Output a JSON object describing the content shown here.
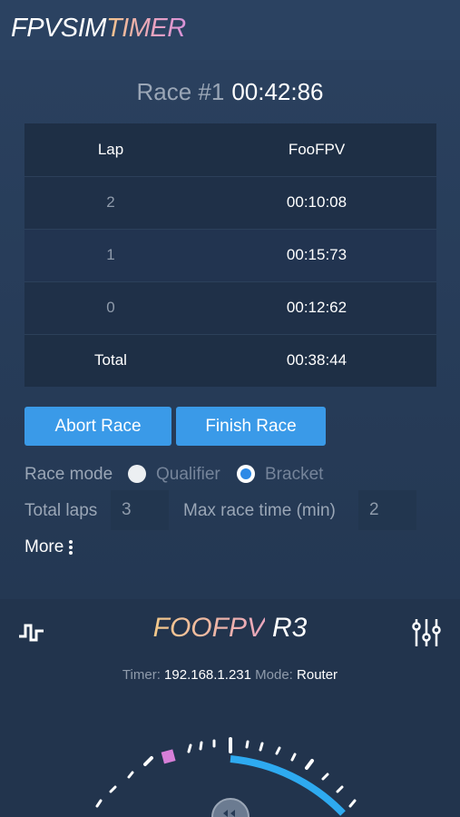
{
  "app": {
    "title_part1": "FPVSIM",
    "title_part2": "TIMER"
  },
  "race": {
    "label": "Race #1",
    "elapsed": "00:42:86"
  },
  "lap_table": {
    "headers": {
      "lap": "Lap",
      "pilot": "FooFPV"
    },
    "rows": [
      {
        "lap": "2",
        "time": "00:10:08"
      },
      {
        "lap": "1",
        "time": "00:15:73"
      },
      {
        "lap": "0",
        "time": "00:12:62"
      }
    ],
    "total": {
      "label": "Total",
      "time": "00:38:44"
    }
  },
  "actions": {
    "abort_label": "Abort Race",
    "finish_label": "Finish Race"
  },
  "settings": {
    "race_mode_label": "Race mode",
    "mode_options": [
      {
        "label": "Qualifier",
        "selected": false
      },
      {
        "label": "Bracket",
        "selected": true
      }
    ],
    "total_laps_label": "Total laps",
    "total_laps_value": "3",
    "max_time_label": "Max race time (min)",
    "max_time_value": "2",
    "more_label": "More"
  },
  "device": {
    "name_part1": "FOOFPV",
    "name_part2": "R3",
    "timer_label": "Timer:",
    "timer_ip": "192.168.1.231",
    "mode_label": "Mode:",
    "mode_value": "Router",
    "left_icon": "signal-pulse-icon",
    "right_icon": "sliders-icon"
  },
  "colors": {
    "accent": "#3a9ae8",
    "gauge_arc": "#2eaaf0",
    "marker": "#d77fd8",
    "background": "#263a55"
  }
}
